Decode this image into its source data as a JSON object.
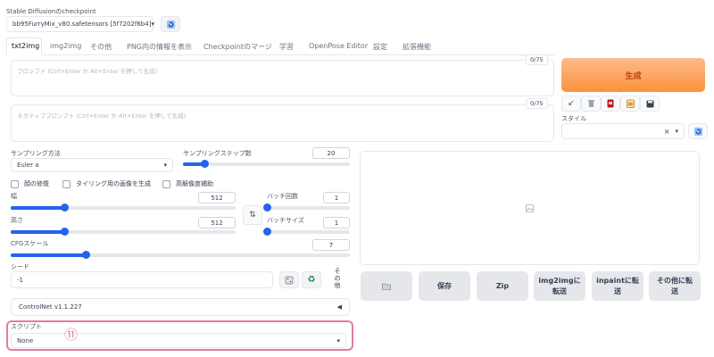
{
  "checkpoint": {
    "label": "Stable Diffusionのcheckpoint",
    "value": "bb95FurryMix_v80.safetensors [5f7202f6b4]",
    "refresh_icon": "refresh-icon"
  },
  "tabs": [
    "txt2img",
    "img2img",
    "その他",
    "PNG内の情報を表示",
    "Checkpointのマージ",
    "学習",
    "OpenPose Editor",
    "設定",
    "拡張機能"
  ],
  "active_tab": 0,
  "prompt": {
    "placeholder": "プロンプト (Ctrl+Enter か Alt+Enter を押して生成)",
    "count": "0/75"
  },
  "neg_prompt": {
    "placeholder": "ネガティブプロンプト (Ctrl+Enter か Alt+Enter を押して生成)",
    "count": "0/75"
  },
  "generate": {
    "label": "生成",
    "color": "#f97316"
  },
  "tool_icons": [
    "arrow-icon",
    "trash-icon",
    "card-icon",
    "clipboard-icon",
    "save-icon"
  ],
  "style": {
    "label": "スタイル",
    "clear": "×",
    "refresh_icon": "refresh-icon"
  },
  "sampler": {
    "label": "サンプリング方法",
    "value": "Euler a"
  },
  "steps": {
    "label": "サンプリングステップ数",
    "value": "20",
    "fraction": 0.13
  },
  "checkboxes": [
    "顔の修復",
    "タイリング用の画像を生成",
    "高解像度補助"
  ],
  "width": {
    "label": "幅",
    "value": "512",
    "fraction": 0.24
  },
  "height": {
    "label": "高さ",
    "value": "512",
    "fraction": 0.24
  },
  "swap_icon": "swap-icon",
  "batch_count": {
    "label": "バッチ回数",
    "value": "1",
    "fraction": 0
  },
  "batch_size": {
    "label": "バッチサイズ",
    "value": "1",
    "fraction": 0
  },
  "cfg": {
    "label": "CFGスケール",
    "value": "7",
    "fraction": 0.22
  },
  "seed": {
    "label": "シード",
    "value": "-1",
    "dice_icon": "dice-icon",
    "recycle_icon": "recycle-icon",
    "extra": "その他"
  },
  "controlnet": {
    "label": "ControlNet v1.1.227",
    "arrow": "◀"
  },
  "script": {
    "label": "スクリプト",
    "value": "None",
    "annotation": "⑪",
    "highlight_color": "#e879a6"
  },
  "gallery": {
    "image_icon": "image-icon"
  },
  "actions": [
    {
      "icon": "folder-icon",
      "label": ""
    },
    {
      "label": "保存"
    },
    {
      "label": "Zip"
    },
    {
      "label": "img2imgに\n転送"
    },
    {
      "label": "inpaintに転\n送"
    },
    {
      "label": "その他に転\n送"
    }
  ]
}
